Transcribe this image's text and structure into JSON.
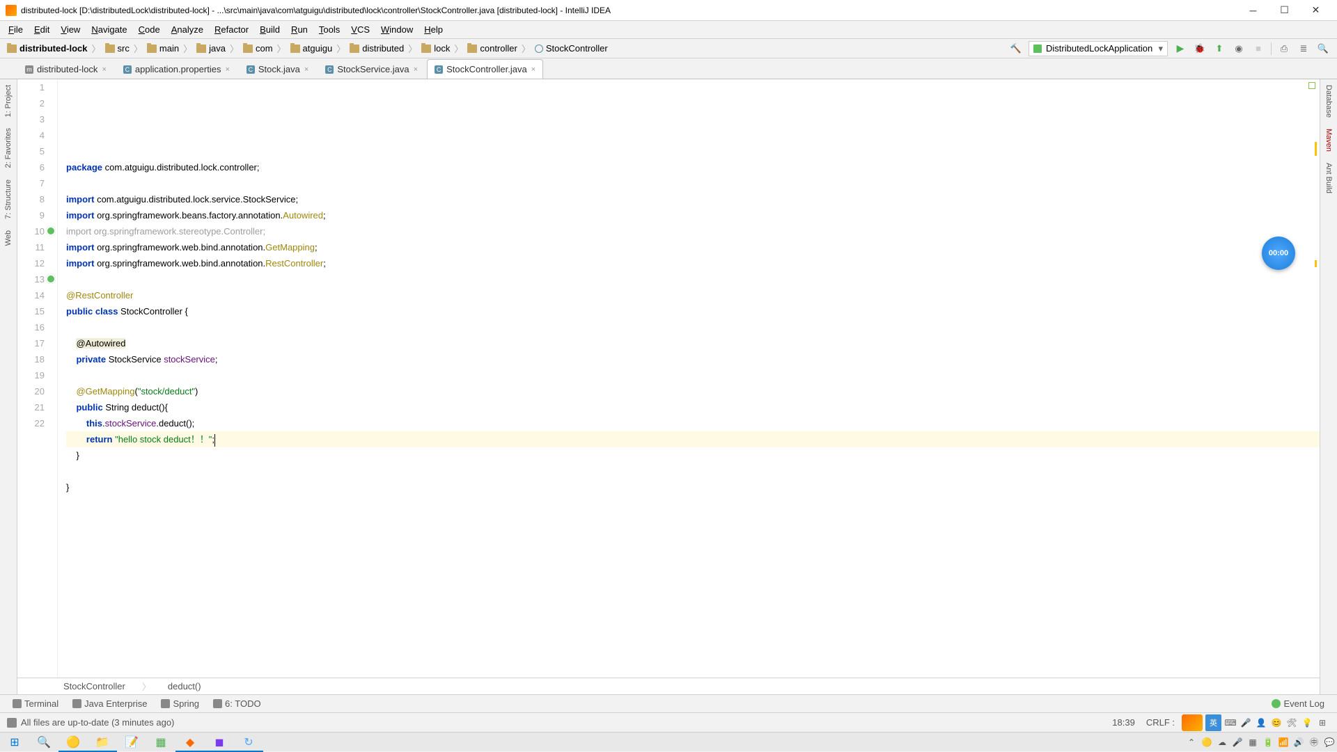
{
  "titlebar": {
    "text": "distributed-lock [D:\\distributedLock\\distributed-lock] - ...\\src\\main\\java\\com\\atguigu\\distributed\\lock\\controller\\StockController.java [distributed-lock] - IntelliJ IDEA"
  },
  "menu": [
    "File",
    "Edit",
    "View",
    "Navigate",
    "Code",
    "Analyze",
    "Refactor",
    "Build",
    "Run",
    "Tools",
    "VCS",
    "Window",
    "Help"
  ],
  "breadcrumbs": [
    "distributed-lock",
    "src",
    "main",
    "java",
    "com",
    "atguigu",
    "distributed",
    "lock",
    "controller",
    "StockController"
  ],
  "runConfig": "DistributedLockApplication",
  "tabs": [
    {
      "label": "distributed-lock",
      "icon": "m"
    },
    {
      "label": "application.properties",
      "icon": "c"
    },
    {
      "label": "Stock.java",
      "icon": "c"
    },
    {
      "label": "StockService.java",
      "icon": "c"
    },
    {
      "label": "StockController.java",
      "icon": "c",
      "active": true
    }
  ],
  "leftTools": [
    "1: Project",
    "2: Favorites",
    "7: Structure",
    "Web"
  ],
  "rightTools": [
    "Database",
    "Maven",
    "Ant Build"
  ],
  "code": {
    "lines": [
      {
        "n": 1,
        "t": [
          {
            "c": "kw",
            "s": "package"
          },
          {
            "s": " com.atguigu.distributed.lock.controller;"
          }
        ]
      },
      {
        "n": 2,
        "t": []
      },
      {
        "n": 3,
        "t": [
          {
            "c": "kw",
            "s": "import"
          },
          {
            "s": " com.atguigu.distributed.lock.service.StockService;"
          }
        ]
      },
      {
        "n": 4,
        "t": [
          {
            "c": "kw",
            "s": "import"
          },
          {
            "s": " org.springframework.beans.factory.annotation."
          },
          {
            "c": "ann",
            "s": "Autowired"
          },
          {
            "s": ";"
          }
        ]
      },
      {
        "n": 5,
        "t": [
          {
            "c": "unused",
            "s": "import org.springframework.stereotype.Controller;"
          }
        ]
      },
      {
        "n": 6,
        "t": [
          {
            "c": "kw",
            "s": "import"
          },
          {
            "s": " org.springframework.web.bind.annotation."
          },
          {
            "c": "ann",
            "s": "GetMapping"
          },
          {
            "s": ";"
          }
        ]
      },
      {
        "n": 7,
        "t": [
          {
            "c": "kw",
            "s": "import"
          },
          {
            "s": " org.springframework.web.bind.annotation."
          },
          {
            "c": "ann",
            "s": "RestController"
          },
          {
            "s": ";"
          }
        ]
      },
      {
        "n": 8,
        "t": []
      },
      {
        "n": 9,
        "t": [
          {
            "c": "ann",
            "s": "@RestController"
          }
        ]
      },
      {
        "n": 10,
        "mark": "spring",
        "t": [
          {
            "c": "kw",
            "s": "public class"
          },
          {
            "s": " StockController {"
          }
        ]
      },
      {
        "n": 11,
        "t": []
      },
      {
        "n": 12,
        "t": [
          {
            "s": "    "
          },
          {
            "c": "ann-hl",
            "s": "@Autowired"
          }
        ]
      },
      {
        "n": 13,
        "mark": "spring",
        "t": [
          {
            "s": "    "
          },
          {
            "c": "kw",
            "s": "private"
          },
          {
            "s": " StockService "
          },
          {
            "c": "field",
            "s": "stockService"
          },
          {
            "s": ";"
          }
        ]
      },
      {
        "n": 14,
        "t": []
      },
      {
        "n": 15,
        "t": [
          {
            "s": "    "
          },
          {
            "c": "ann",
            "s": "@GetMapping"
          },
          {
            "s": "("
          },
          {
            "c": "str",
            "s": "\"stock/deduct\""
          },
          {
            "s": ")"
          }
        ]
      },
      {
        "n": 16,
        "t": [
          {
            "s": "    "
          },
          {
            "c": "kw",
            "s": "public"
          },
          {
            "s": " String deduct(){"
          }
        ]
      },
      {
        "n": 17,
        "t": [
          {
            "s": "        "
          },
          {
            "c": "kw",
            "s": "this"
          },
          {
            "s": "."
          },
          {
            "c": "field",
            "s": "stockService"
          },
          {
            "s": ".deduct();"
          }
        ]
      },
      {
        "n": 18,
        "current": true,
        "bulb": true,
        "t": [
          {
            "s": "        "
          },
          {
            "c": "kw",
            "s": "return"
          },
          {
            "s": " "
          },
          {
            "c": "str",
            "s": "\"hello stock deduct！！\""
          },
          {
            "s": ";"
          }
        ],
        "cursor": true
      },
      {
        "n": 19,
        "t": [
          {
            "s": "    }"
          }
        ]
      },
      {
        "n": 20,
        "t": []
      },
      {
        "n": 21,
        "t": [
          {
            "s": "}"
          }
        ]
      },
      {
        "n": 22,
        "t": []
      }
    ]
  },
  "crumbbar": [
    "StockController",
    "deduct()"
  ],
  "timer": "00:00",
  "bottomTabs": [
    "Terminal",
    "Java Enterprise",
    "Spring",
    "6: TODO"
  ],
  "eventLog": "Event Log",
  "status": {
    "msg": "All files are up-to-date (3 minutes ago)",
    "pos": "18:39",
    "lineEnd": "CRLF :",
    "ime": "英"
  }
}
